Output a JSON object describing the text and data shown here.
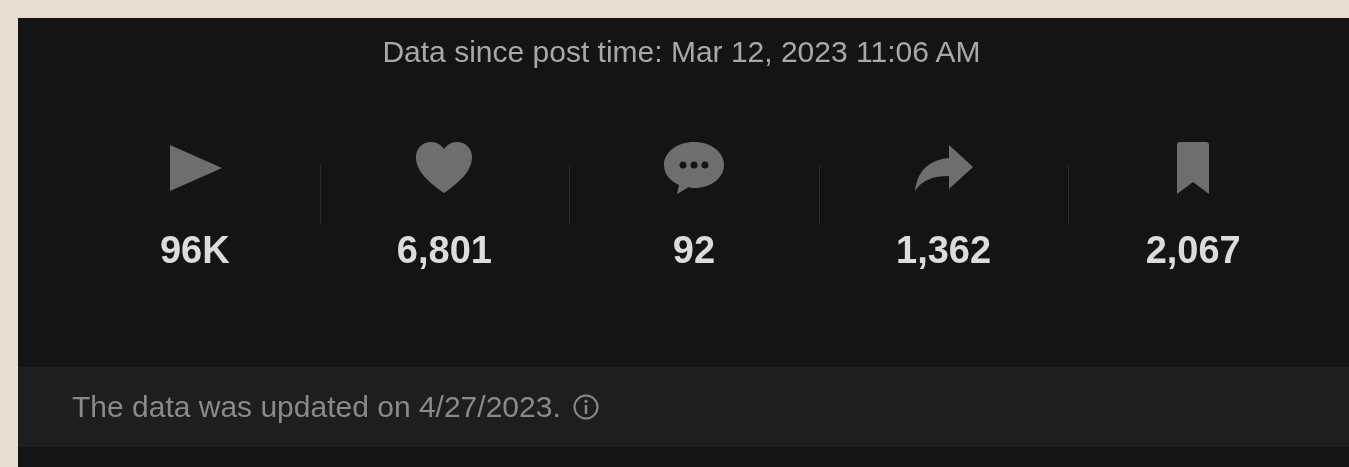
{
  "header": "Data since post time: Mar 12, 2023 11:06 AM",
  "stats": [
    {
      "kind": "play",
      "value": "96K"
    },
    {
      "kind": "heart",
      "value": "6,801"
    },
    {
      "kind": "comment",
      "value": "92"
    },
    {
      "kind": "share",
      "value": "1,362"
    },
    {
      "kind": "bookmark",
      "value": "2,067"
    }
  ],
  "footer": {
    "text": "The data was updated on 4/27/2023."
  }
}
